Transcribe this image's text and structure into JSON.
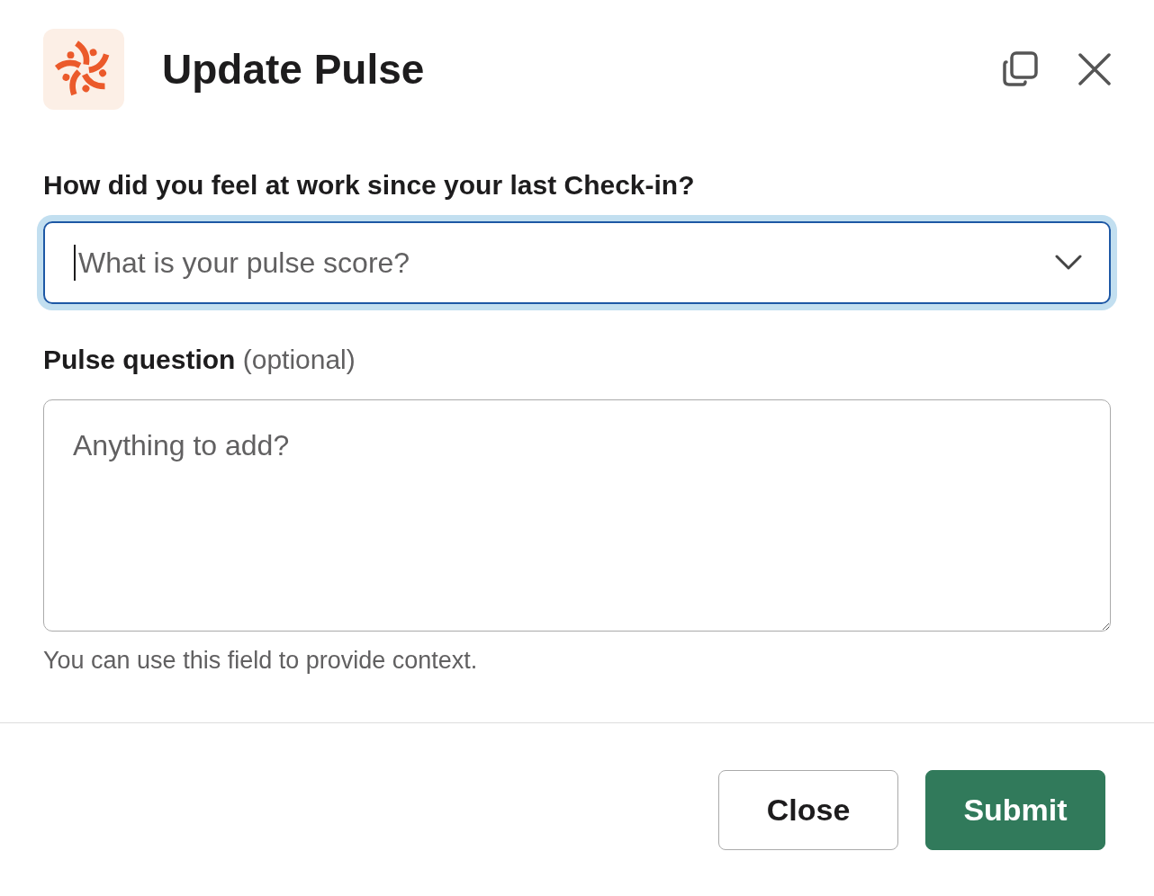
{
  "modal": {
    "title": "Update Pulse"
  },
  "fields": [
    {
      "kind": "select",
      "label": "How did you feel at work since your last Check-in?",
      "placeholder": "What is your pulse score?",
      "focused": true
    },
    {
      "kind": "textarea",
      "label": "Pulse question",
      "label_note": "(optional)",
      "placeholder": "Anything to add?",
      "hint": "You can use this field to provide context.",
      "focused": false
    }
  ],
  "buttons": [
    {
      "label": "Close",
      "kind": "secondary"
    },
    {
      "label": "Submit",
      "kind": "primary"
    }
  ]
}
